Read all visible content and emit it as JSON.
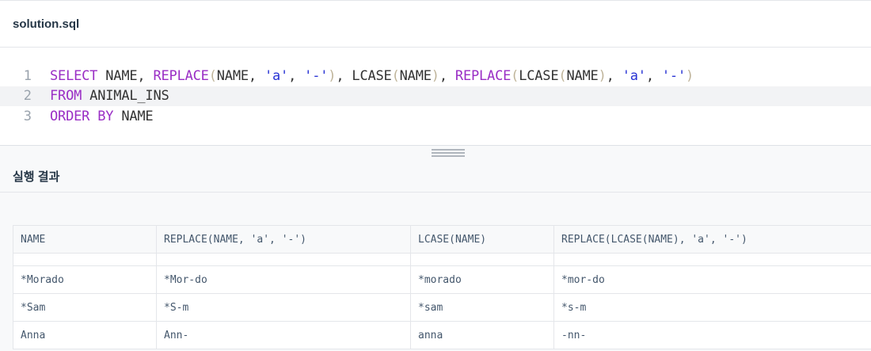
{
  "editor": {
    "file_name": "solution.sql",
    "lines": [
      {
        "number": "1",
        "tokens": [
          {
            "t": "SELECT",
            "c": "kw"
          },
          {
            "t": " NAME, ",
            "c": ""
          },
          {
            "t": "REPLACE",
            "c": "kw"
          },
          {
            "t": "(",
            "c": "paren"
          },
          {
            "t": "NAME, ",
            "c": ""
          },
          {
            "t": "'a'",
            "c": "str"
          },
          {
            "t": ", ",
            "c": ""
          },
          {
            "t": "'-'",
            "c": "str"
          },
          {
            "t": ")",
            "c": "paren"
          },
          {
            "t": ", ",
            "c": ""
          },
          {
            "t": "LCASE",
            "c": ""
          },
          {
            "t": "(",
            "c": "paren"
          },
          {
            "t": "NAME",
            "c": ""
          },
          {
            "t": ")",
            "c": "paren"
          },
          {
            "t": ", ",
            "c": ""
          },
          {
            "t": "REPLACE",
            "c": "kw"
          },
          {
            "t": "(",
            "c": "paren"
          },
          {
            "t": "LCASE",
            "c": ""
          },
          {
            "t": "(",
            "c": "paren"
          },
          {
            "t": "NAME",
            "c": ""
          },
          {
            "t": ")",
            "c": "paren"
          },
          {
            "t": ", ",
            "c": ""
          },
          {
            "t": "'a'",
            "c": "str"
          },
          {
            "t": ", ",
            "c": ""
          },
          {
            "t": "'-'",
            "c": "str"
          },
          {
            "t": ")",
            "c": "paren"
          }
        ]
      },
      {
        "number": "2",
        "active": true,
        "tokens": [
          {
            "t": "FROM",
            "c": "kw"
          },
          {
            "t": " ANIMAL_INS",
            "c": ""
          }
        ]
      },
      {
        "number": "3",
        "tokens": [
          {
            "t": "ORDER BY",
            "c": "kw"
          },
          {
            "t": " NAME",
            "c": ""
          }
        ]
      }
    ]
  },
  "result": {
    "title": "실행 결과",
    "columns": [
      "NAME",
      "REPLACE(NAME, 'a', '-')",
      "LCASE(NAME)",
      "REPLACE(LCASE(NAME), 'a', '-')"
    ],
    "rows": [
      [
        "*Morado",
        "*Mor-do",
        "*morado",
        "*mor-do"
      ],
      [
        "*Sam",
        "*S-m",
        "*sam",
        "*s-m"
      ],
      [
        "Anna",
        "Ann-",
        "anna",
        "-nn-"
      ]
    ]
  },
  "colors": {
    "keyword": "#9a2ec5",
    "string": "#2833d4",
    "paren": "#bfb49a",
    "active_line": "#f2f3f5"
  }
}
